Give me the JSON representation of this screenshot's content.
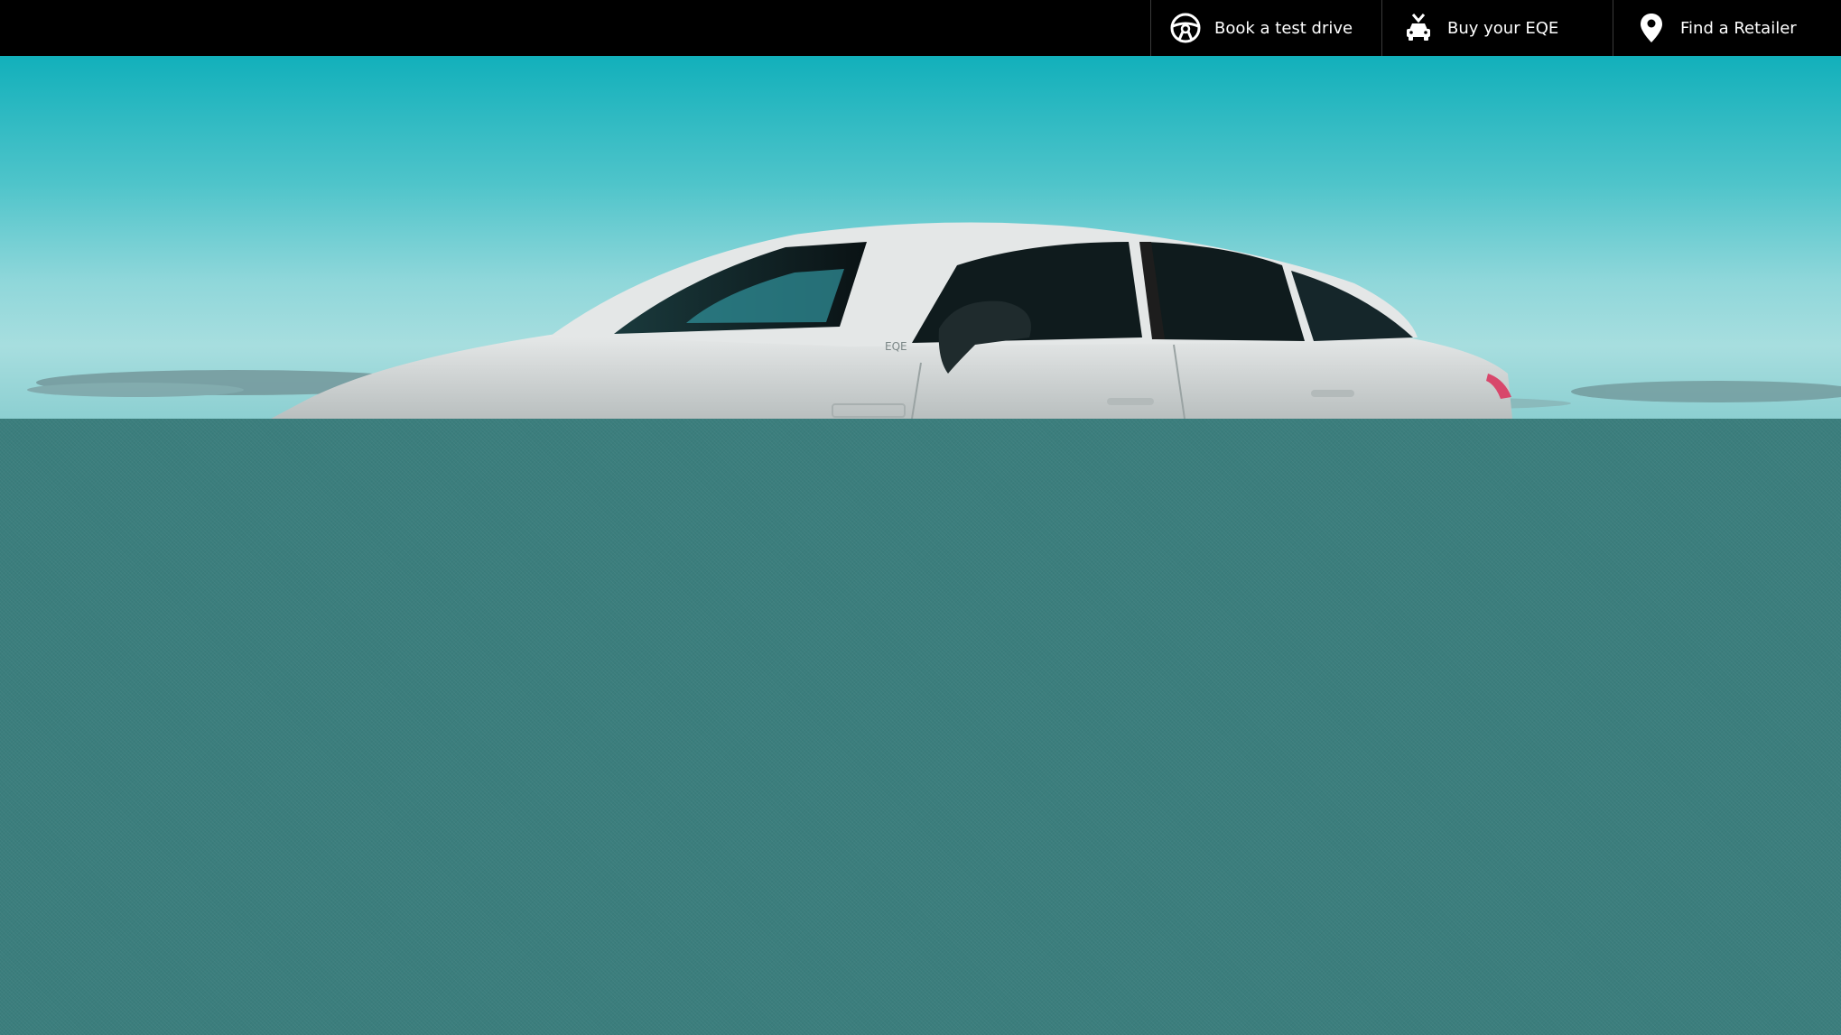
{
  "nav": {
    "items": [
      {
        "label": "Book a test drive",
        "icon": "steering-wheel-icon"
      },
      {
        "label": "Buy your EQE",
        "icon": "car-checkout-icon"
      },
      {
        "label": "Find a Retailer",
        "icon": "location-pin-icon"
      }
    ]
  },
  "hero": {
    "badge_text": "EQE"
  },
  "colors": {
    "topbar": "#000000",
    "panel": "#3b7e7d",
    "sky_top": "#12b0bb",
    "sky_mid": "#8fd7da",
    "car_body": "#d9dcdc"
  }
}
